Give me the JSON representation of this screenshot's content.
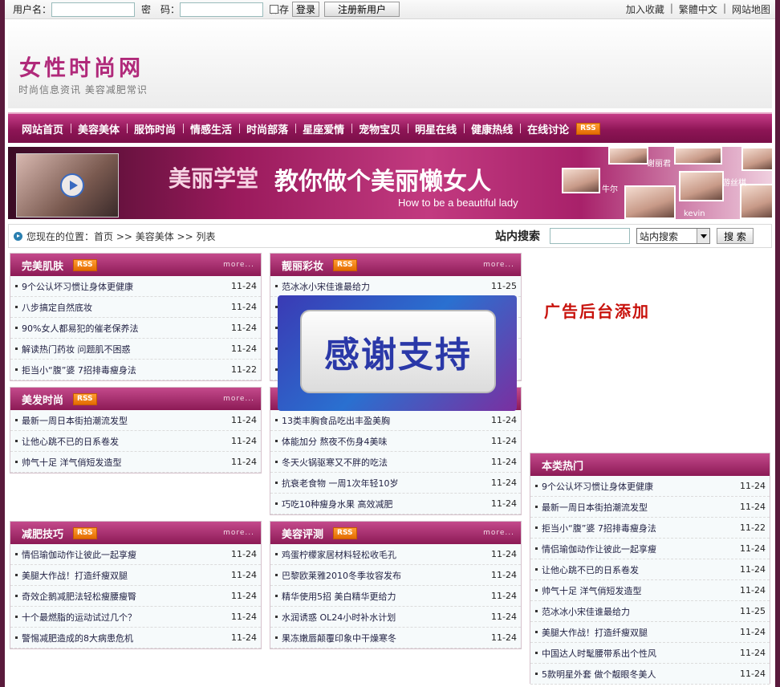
{
  "topbar": {
    "username_label": "用户名：",
    "password_label": "密　码：",
    "save_label": "保存",
    "login_button": "登录",
    "register_button": "注册新用户",
    "links": [
      "加入收藏",
      "繁體中文",
      "网站地图"
    ]
  },
  "header": {
    "title": "女性时尚网",
    "subtitle": "时尚信息资讯 美容减肥常识"
  },
  "nav": {
    "items": [
      "网站首页",
      "美容美体",
      "服饰时尚",
      "情感生活",
      "时尚部落",
      "星座爱情",
      "宠物宝贝",
      "明星在线",
      "健康热线",
      "在线讨论"
    ],
    "rss": "RSS"
  },
  "banner": {
    "text1": "美丽学堂",
    "text2": "教你做个美丽懒女人",
    "text3": "How to be a beautiful lady",
    "names": [
      "谢丽君",
      "牛尔",
      "游丝棋",
      "kevin"
    ]
  },
  "location": {
    "text": "您现在的位置：首页 >> 美容美体 >> 列表",
    "search_title": "站内搜索",
    "select_value": "站内搜索",
    "search_button": "搜 索"
  },
  "more_label": "more...",
  "rss_label": "RSS",
  "boxes": {
    "skin": {
      "title": "完美肌肤",
      "items": [
        {
          "t": "9个公认坏习惯让身体更健康",
          "d": "11-24"
        },
        {
          "t": "八步搞定自然底妆",
          "d": "11-24"
        },
        {
          "t": "90%女人都易犯的催老保养法",
          "d": "11-24"
        },
        {
          "t": "解读热门药妆 问题肌不困惑",
          "d": "11-24"
        },
        {
          "t": "拒当小“腹”婆 7招排毒瘦身法",
          "d": "11-22"
        }
      ]
    },
    "makeup": {
      "title": "靓丽彩妆",
      "items": [
        {
          "t": "范冰冰小宋佳谁最给力",
          "d": "11-25"
        }
      ]
    },
    "hair": {
      "title": "美发时尚",
      "items": [
        {
          "t": "最新一周日本街拍潮流发型",
          "d": "11-24"
        },
        {
          "t": "让他心跳不已的日系卷发",
          "d": "11-24"
        },
        {
          "t": "帅气十足 洋气俏短发造型",
          "d": "11-24"
        }
      ]
    },
    "diet": {
      "items": [
        {
          "t": "13类丰胸食品吃出丰盈美胸",
          "d": "11-24"
        },
        {
          "t": "体能加分 熬夜不伤身4美味",
          "d": "11-24"
        },
        {
          "t": "冬天火锅驱寒又不胖的吃法",
          "d": "11-24"
        },
        {
          "t": "抗衰老食物 一周1次年轻10岁",
          "d": "11-24"
        },
        {
          "t": "巧吃10种瘦身水果 高效减肥",
          "d": "11-24"
        }
      ]
    },
    "slim": {
      "title": "减肥技巧",
      "items": [
        {
          "t": "情侣瑜伽动作让彼此一起享瘦",
          "d": "11-24"
        },
        {
          "t": "美腿大作战！打造纤瘦双腿",
          "d": "11-24"
        },
        {
          "t": "奇效企鹅减肥法轻松瘦腰瘦臀",
          "d": "11-24"
        },
        {
          "t": "十个最燃脂的运动试过几个？",
          "d": "11-24"
        },
        {
          "t": "警惕减肥造成的8大病患危机",
          "d": "11-24"
        }
      ]
    },
    "review": {
      "title": "美容评测",
      "items": [
        {
          "t": "鸡蛋柠檬家居材料轻松收毛孔",
          "d": "11-24"
        },
        {
          "t": "巴黎欧莱雅2010冬季妆容发布",
          "d": "11-24"
        },
        {
          "t": "精华使用5招 美白精华更给力",
          "d": "11-24"
        },
        {
          "t": "水润诱惑 OL24小时补水计划",
          "d": "11-24"
        },
        {
          "t": "果冻嫩唇颠覆印象中干燥寒冬",
          "d": "11-24"
        }
      ]
    },
    "hot": {
      "title": "本类热门",
      "items": [
        {
          "t": "9个公认坏习惯让身体更健康",
          "d": "11-24"
        },
        {
          "t": "最新一周日本街拍潮流发型",
          "d": "11-24"
        },
        {
          "t": "拒当小“腹”婆 7招排毒瘦身法",
          "d": "11-22"
        },
        {
          "t": "情侣瑜伽动作让彼此一起享瘦",
          "d": "11-24"
        },
        {
          "t": "让他心跳不已的日系卷发",
          "d": "11-24"
        },
        {
          "t": "帅气十足 洋气俏短发造型",
          "d": "11-24"
        },
        {
          "t": "范冰冰小宋佳谁最给力",
          "d": "11-25"
        },
        {
          "t": "美腿大作战！打造纤瘦双腿",
          "d": "11-24"
        },
        {
          "t": "中国达人时髦腰带系出个性风",
          "d": "11-24"
        },
        {
          "t": "5款明星外套 做个靓眼冬美人",
          "d": "11-24"
        }
      ]
    }
  },
  "ad_text": "广告后台添加",
  "overlay_text": "感谢支持"
}
